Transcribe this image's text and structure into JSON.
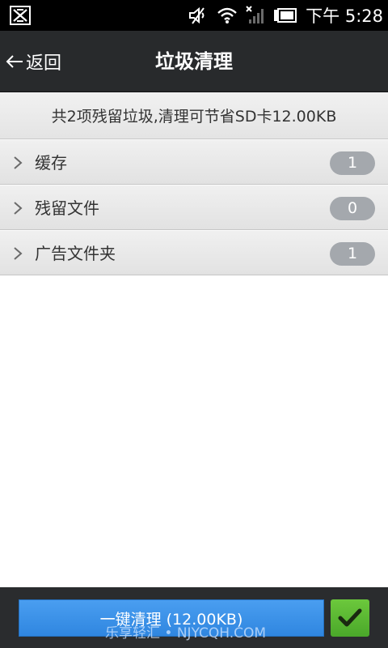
{
  "status_bar": {
    "time": "下午 5:28",
    "icons": [
      "app-notification-icon",
      "silent-mode-icon",
      "wifi-icon",
      "no-signal-icon",
      "battery-icon"
    ]
  },
  "title_bar": {
    "back_label": "返回",
    "title": "垃圾清理"
  },
  "summary": {
    "text": "共2项残留垃圾,清理可节省SD卡12.00KB"
  },
  "items": [
    {
      "label": "缓存",
      "count": "1"
    },
    {
      "label": "残留文件",
      "count": "0"
    },
    {
      "label": "广告文件夹",
      "count": "1"
    }
  ],
  "bottom_bar": {
    "clean_label": "一键清理 (12.00KB)",
    "watermark": "乐享轻汇 • NJYCQH.COM"
  },
  "colors": {
    "accent_blue": "#2f86e0",
    "confirm_green": "#4aa82a",
    "badge_gray": "#a4a8ad",
    "title_bar": "#282a2c"
  }
}
